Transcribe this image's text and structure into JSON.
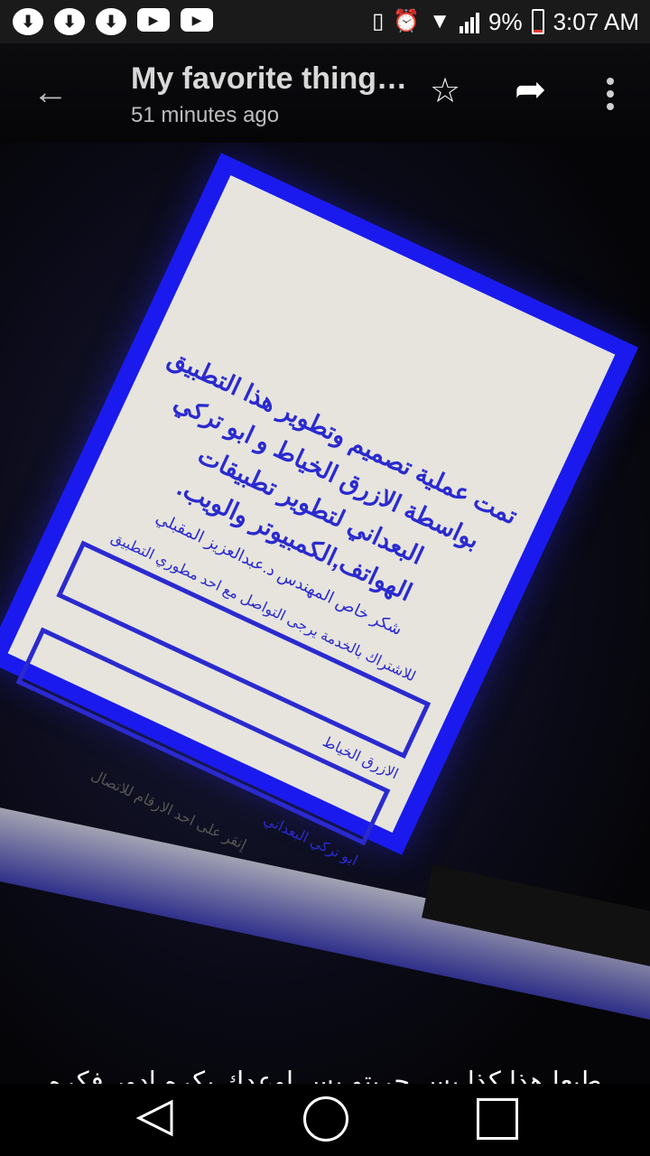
{
  "status_bar": {
    "battery": "9%",
    "time": "3:07 AM"
  },
  "app_bar": {
    "title": "My favorite thing…",
    "subtitle": "51 minutes ago"
  },
  "photo": {
    "heading": "تمت عملية تصميم وتطوير هذا التطبيق بواسطة الازرق الخياط و ابو تركي البعداني لتطوير تطبيقات الهواتف,الكمبيوتر والويب.",
    "thanks": "شكر خاص المهندس د.عبدالعزيز المقبلي",
    "subscribe_note": "للاشتراك بالخدمة يرجى التواصل مع احد مطوري التطبيق",
    "name_1": "الازرق الخياط",
    "name_2": "ابو تركي البعداني",
    "footer": "إنقر على احد الارقام للاتصال"
  },
  "caption": "طبعا هذا كذا بس جربتو بس اوعدك بكره ادور فكره جديد من النت واصمم عاده ناقص الشعار حقك والارقام",
  "icons": {
    "download": "download-icon",
    "youtube": "youtube-icon",
    "vibrate": "vibrate-icon",
    "alarm": "alarm-icon",
    "wifi": "wifi-icon",
    "signal": "signal-icon",
    "battery": "battery-icon",
    "back": "arrow-back-icon",
    "star": "star-icon",
    "share": "share-icon",
    "more": "more-vert-icon"
  },
  "colors": {
    "accent_blue": "#1a1aee",
    "battery_low": "#e53935"
  }
}
